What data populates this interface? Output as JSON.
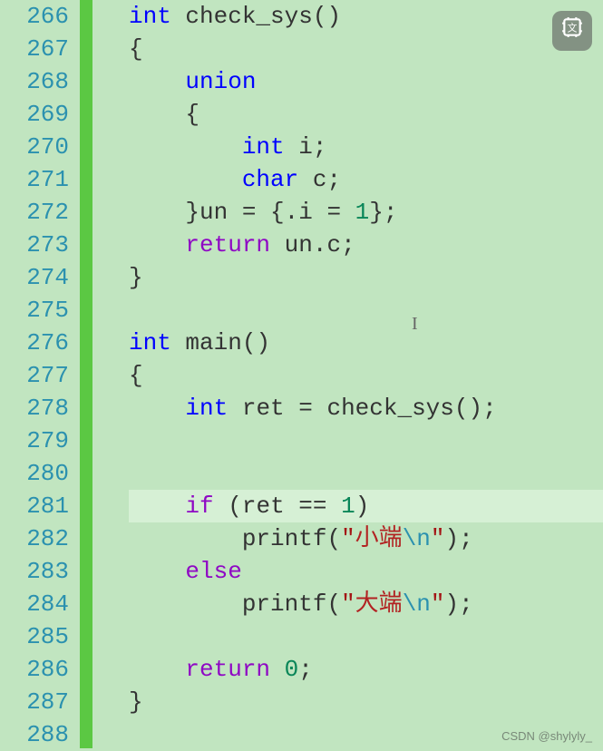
{
  "startLine": 266,
  "endLine": 288,
  "highlightedLine": 281,
  "watermark": "CSDN @shylyly_",
  "code": {
    "266": [
      [
        "kw",
        "int"
      ],
      [
        "punct",
        " "
      ],
      [
        "func",
        "check_sys"
      ],
      [
        "punct",
        "()"
      ]
    ],
    "267": [
      [
        "punct",
        "{"
      ]
    ],
    "268": [
      [
        "punct",
        "    "
      ],
      [
        "kw",
        "union"
      ]
    ],
    "269": [
      [
        "punct",
        "    {"
      ]
    ],
    "270": [
      [
        "punct",
        "        "
      ],
      [
        "kw",
        "int"
      ],
      [
        "punct",
        " "
      ],
      [
        "ident",
        "i"
      ],
      [
        "punct",
        ";"
      ]
    ],
    "271": [
      [
        "punct",
        "        "
      ],
      [
        "kw",
        "char"
      ],
      [
        "punct",
        " "
      ],
      [
        "ident",
        "c"
      ],
      [
        "punct",
        ";"
      ]
    ],
    "272": [
      [
        "punct",
        "    }"
      ],
      [
        "ident",
        "un"
      ],
      [
        "punct",
        " = {."
      ],
      [
        "ident",
        "i"
      ],
      [
        "punct",
        " = "
      ],
      [
        "num",
        "1"
      ],
      [
        "punct",
        "};"
      ]
    ],
    "273": [
      [
        "punct",
        "    "
      ],
      [
        "ret",
        "return"
      ],
      [
        "punct",
        " "
      ],
      [
        "ident",
        "un"
      ],
      [
        "punct",
        "."
      ],
      [
        "ident",
        "c"
      ],
      [
        "punct",
        ";"
      ]
    ],
    "274": [
      [
        "punct",
        "}"
      ]
    ],
    "275": [],
    "276": [
      [
        "kw",
        "int"
      ],
      [
        "punct",
        " "
      ],
      [
        "func",
        "main"
      ],
      [
        "punct",
        "()"
      ]
    ],
    "277": [
      [
        "punct",
        "{"
      ]
    ],
    "278": [
      [
        "punct",
        "    "
      ],
      [
        "kw",
        "int"
      ],
      [
        "punct",
        " "
      ],
      [
        "ident",
        "ret"
      ],
      [
        "punct",
        " = "
      ],
      [
        "func",
        "check_sys"
      ],
      [
        "punct",
        "();"
      ]
    ],
    "279": [],
    "280": [],
    "281": [
      [
        "punct",
        "    "
      ],
      [
        "ret",
        "if"
      ],
      [
        "punct",
        " ("
      ],
      [
        "ident",
        "ret"
      ],
      [
        "punct",
        " == "
      ],
      [
        "num",
        "1"
      ],
      [
        "punct",
        ")"
      ]
    ],
    "282": [
      [
        "punct",
        "        "
      ],
      [
        "func",
        "printf"
      ],
      [
        "punct",
        "("
      ],
      [
        "str",
        "\""
      ],
      [
        "strcn",
        "小端"
      ],
      [
        "esc",
        "\\n"
      ],
      [
        "str",
        "\""
      ],
      [
        "punct",
        ");"
      ]
    ],
    "283": [
      [
        "punct",
        "    "
      ],
      [
        "ret",
        "else"
      ]
    ],
    "284": [
      [
        "punct",
        "        "
      ],
      [
        "func",
        "printf"
      ],
      [
        "punct",
        "("
      ],
      [
        "str",
        "\""
      ],
      [
        "strcn",
        "大端"
      ],
      [
        "esc",
        "\\n"
      ],
      [
        "str",
        "\""
      ],
      [
        "punct",
        ");"
      ]
    ],
    "285": [],
    "286": [
      [
        "punct",
        "    "
      ],
      [
        "ret",
        "return"
      ],
      [
        "punct",
        " "
      ],
      [
        "num",
        "0"
      ],
      [
        "punct",
        ";"
      ]
    ],
    "287": [
      [
        "punct",
        "}"
      ]
    ],
    "288": []
  }
}
